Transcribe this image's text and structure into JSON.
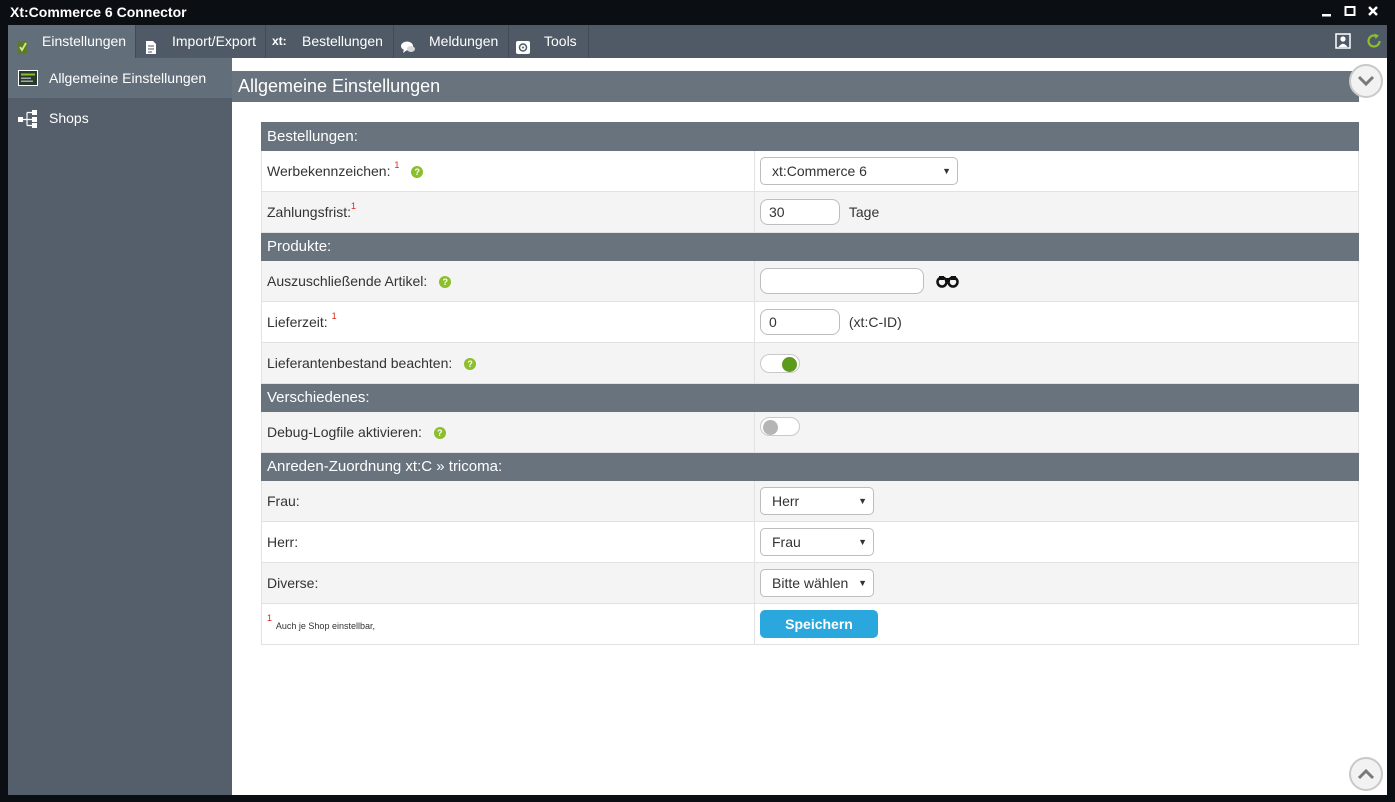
{
  "window": {
    "title": "Xt:Commerce 6 Connector",
    "controls": [
      "minimize-icon",
      "maximize-icon",
      "close-icon"
    ]
  },
  "menu": {
    "items": [
      {
        "label": "Einstellungen",
        "icon": "checklist-icon",
        "active": true
      },
      {
        "label": "Import/Export",
        "icon": "document-icon",
        "active": false
      },
      {
        "label": "Bestellungen",
        "icon_text": "xt:",
        "active": false
      },
      {
        "label": "Meldungen",
        "icon": "chat-bubbles-icon",
        "active": false
      },
      {
        "label": "Tools",
        "icon": "tools-icon",
        "active": false
      }
    ],
    "right_icons": [
      "user-profile-icon",
      "refresh-icon"
    ]
  },
  "sidebar": {
    "items": [
      {
        "label": "Allgemeine Einstellungen",
        "icon": "settings-panel-icon",
        "active": true
      },
      {
        "label": "Shops",
        "icon": "network-icon",
        "active": false
      }
    ]
  },
  "page": {
    "title": "Allgemeine Einstellungen"
  },
  "form": {
    "sections": {
      "bestellungen": "Bestellungen:",
      "produkte": "Produkte:",
      "verschiedenes": "Verschiedenes:",
      "anreden": "Anreden-Zuordnung xt:C » tricoma:"
    },
    "required_mark": "1",
    "help_mark": "?",
    "werbekennzeichen": {
      "label": "Werbekennzeichen:",
      "value": "xt:Commerce 6"
    },
    "zahlungsfrist": {
      "label": "Zahlungsfrist:",
      "value": "30",
      "unit": "Tage"
    },
    "auszuschliessende": {
      "label": "Auszuschließende Artikel:",
      "value": ""
    },
    "lieferzeit": {
      "label": "Lieferzeit:",
      "value": "0",
      "unit": "(xt:C-ID)"
    },
    "lieferantenbestand": {
      "label": "Lieferantenbestand beachten:",
      "on": true
    },
    "debug_logfile": {
      "label": "Debug-Logfile aktivieren:",
      "on": false
    },
    "frau": {
      "label": "Frau:",
      "value": "Herr"
    },
    "herr": {
      "label": "Herr:",
      "value": "Frau"
    },
    "diverse": {
      "label": "Diverse:",
      "value": "Bitte wählen"
    },
    "footnote": "Auch je Shop einstellbar,",
    "save_label": "Speichern"
  },
  "colors": {
    "accent_button": "#2aa7dc",
    "help_icon": "#8bbf2b",
    "required_marker": "#e0251a",
    "toggle_on": "#5b9a1a",
    "section_header": "#68737e"
  }
}
